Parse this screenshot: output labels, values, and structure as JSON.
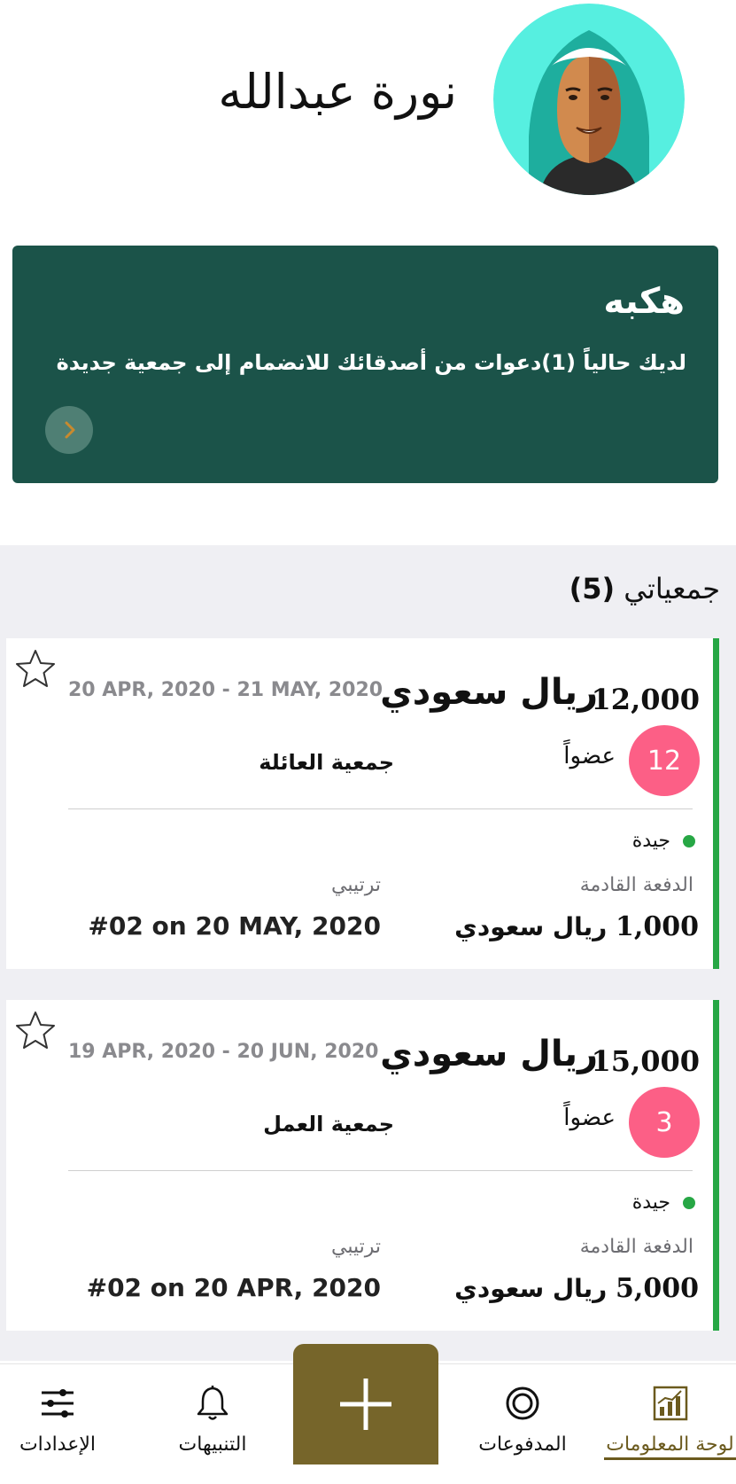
{
  "profile": {
    "name": "نورة عبدالله"
  },
  "banner": {
    "title": "هكبه",
    "message": "لديك حالياً (1)دعوات من أصدقائك للانضمام إلى جمعية جديدة"
  },
  "groups": {
    "title_label": "جمعياتي",
    "count": "(5)",
    "items": [
      {
        "amount": "12,000",
        "currency": "ريال سعودي",
        "dates": "20 APR, 2020 - 21 MAY, 2020",
        "members_count": "12",
        "members_label": "عضواً",
        "name": "جمعية العائلة",
        "status": "جيدة",
        "next_payment_label": "الدفعة القادمة",
        "next_payment_amount": "1,000",
        "next_payment_currency": "ريال سعودي",
        "rank_label": "ترتيبي",
        "rank_value": "#02 on 20 MAY, 2020"
      },
      {
        "amount": "15,000",
        "currency": "ريال سعودي",
        "dates": "19 APR, 2020 - 20 JUN, 2020",
        "members_count": "3",
        "members_label": "عضواً",
        "name": "جمعية العمل",
        "status": "جيدة",
        "next_payment_label": "الدفعة القادمة",
        "next_payment_amount": "5,000",
        "next_payment_currency": "ريال سعودي",
        "rank_label": "ترتيبي",
        "rank_value": "#02 on 20 APR, 2020"
      }
    ]
  },
  "nav": {
    "dashboard": "لوحة المعلومات",
    "payments": "المدفوعات",
    "notifications": "التنبيهات",
    "settings": "الإعدادات",
    "active": "dashboard"
  },
  "colors": {
    "banner_bg": "#1b5349",
    "accent_gold": "#76652a",
    "status_green": "#27a745",
    "badge_pink": "#fc5f86"
  },
  "icons": {
    "banner_arrow": "chevron-right-icon",
    "favorite": "star-outline-icon",
    "dashboard": "chart-icon",
    "payments": "target-icon",
    "notifications": "bell-icon",
    "settings": "sliders-icon",
    "add": "plus-icon"
  }
}
